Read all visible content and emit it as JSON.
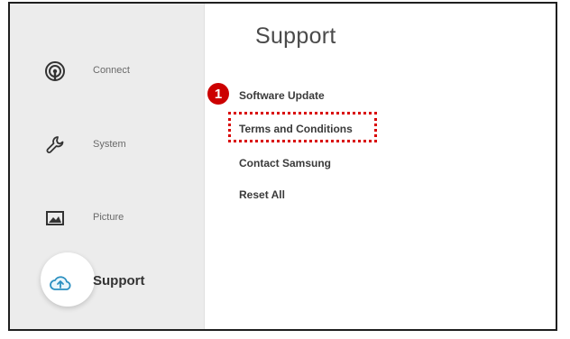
{
  "sidebar": {
    "items": [
      {
        "label": "Connect",
        "icon": "connect-icon"
      },
      {
        "label": "System",
        "icon": "wrench-icon"
      },
      {
        "label": "Picture",
        "icon": "picture-icon"
      },
      {
        "label": "Support",
        "icon": "cloud-support-icon",
        "active": true
      }
    ]
  },
  "main": {
    "title": "Support",
    "menu": [
      {
        "label": "Software Update"
      },
      {
        "label": "Terms and Conditions"
      },
      {
        "label": "Contact Samsung"
      },
      {
        "label": "Reset All"
      }
    ],
    "step_badge": "1"
  },
  "colors": {
    "highlight": "#d90000",
    "badge": "#cc0000",
    "sidebar_bg": "#ececec"
  }
}
